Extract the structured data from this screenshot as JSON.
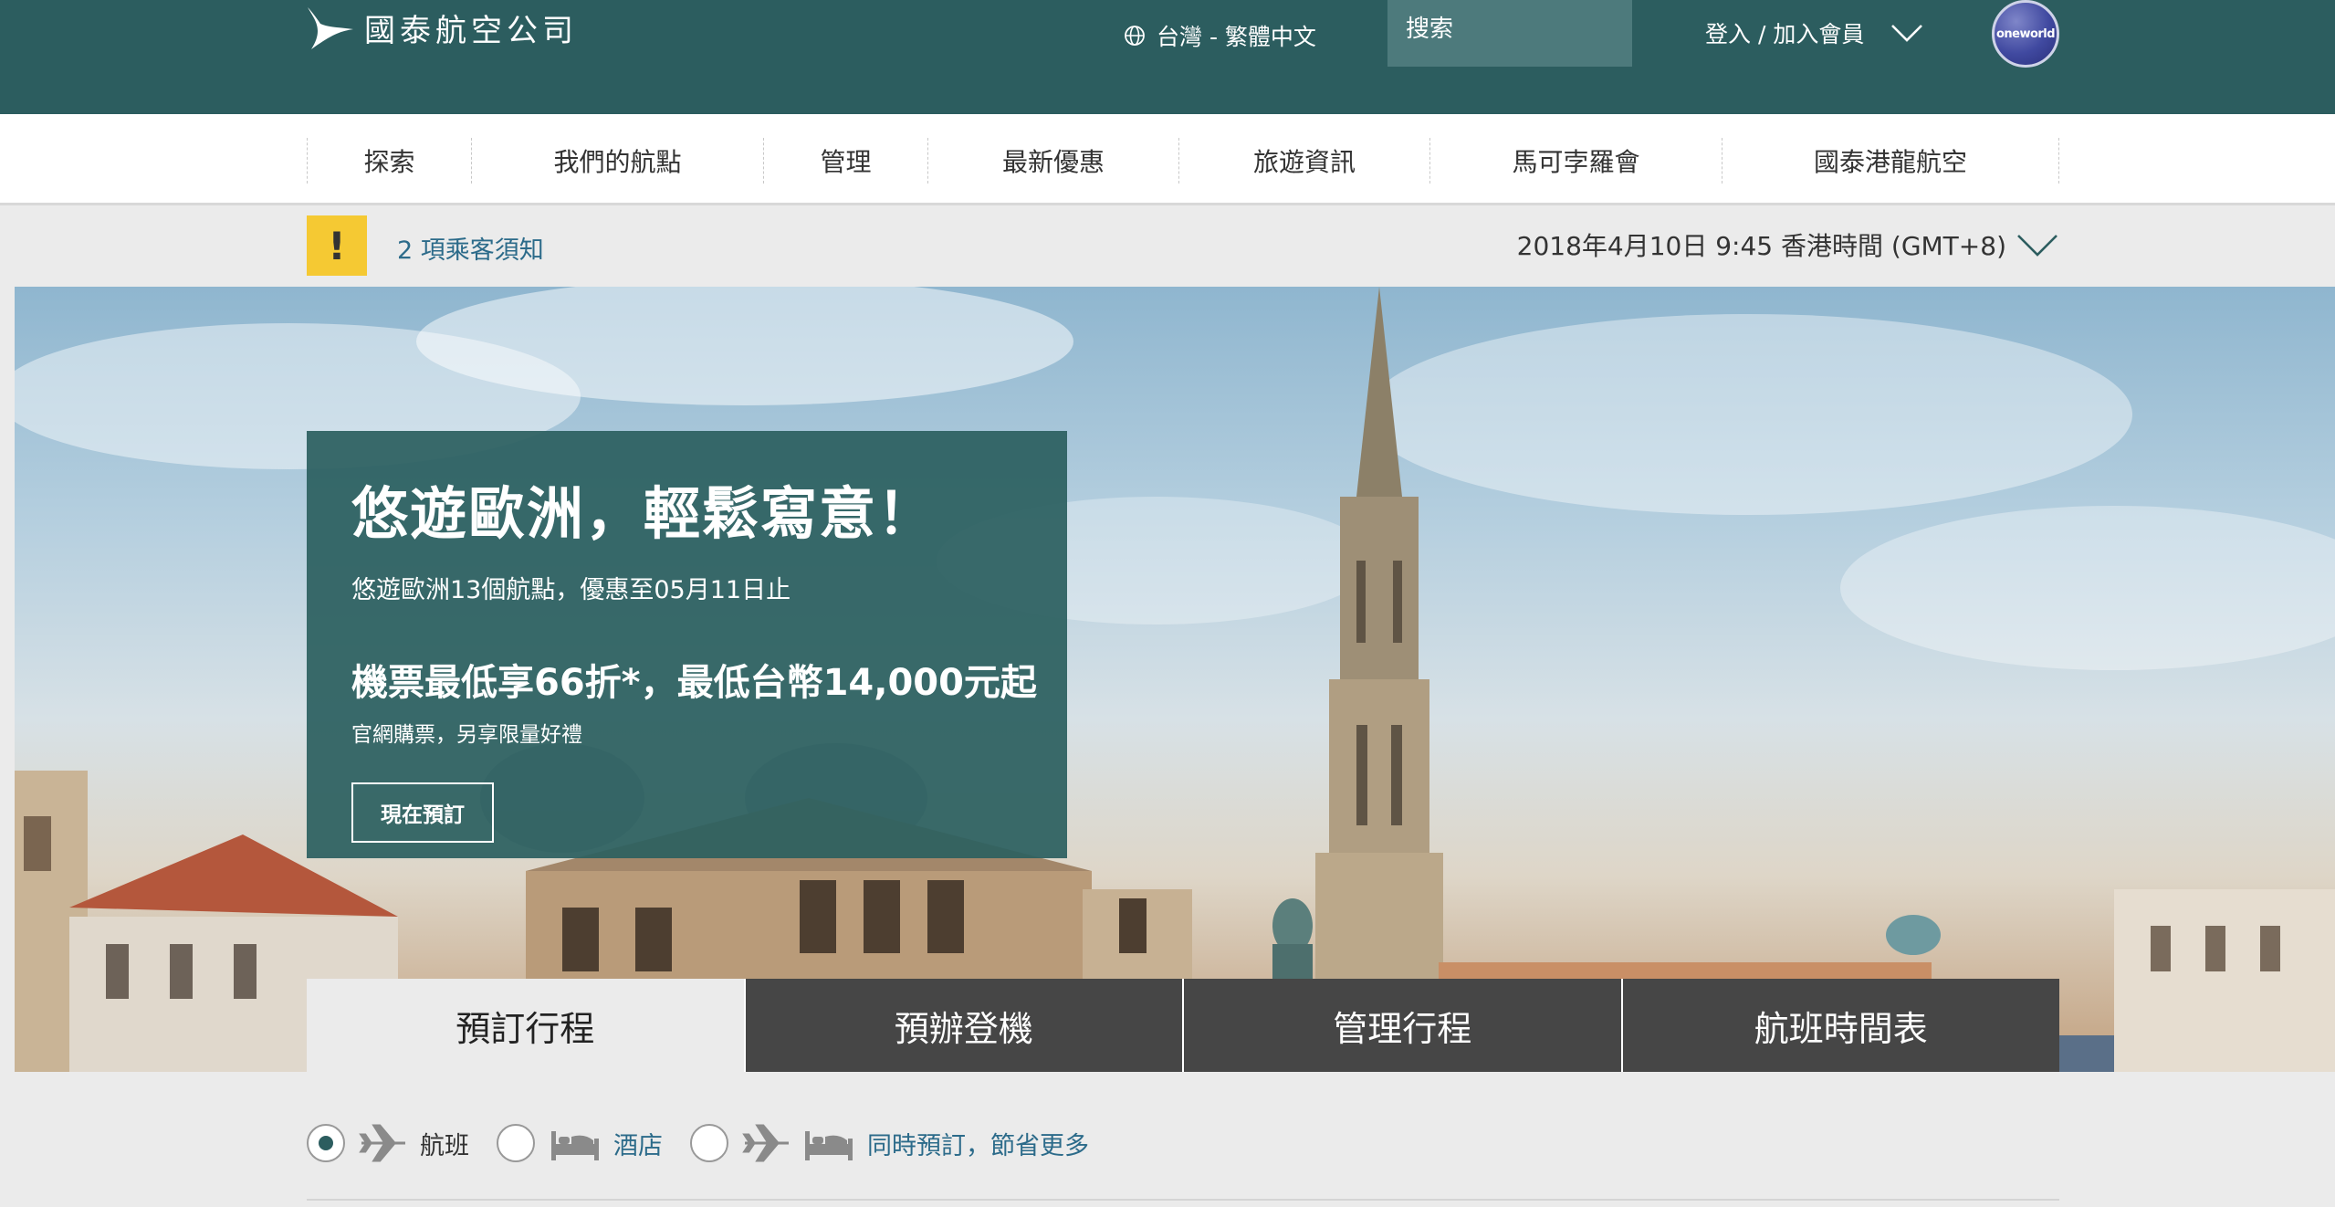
{
  "header": {
    "logo_text": "國泰航空公司",
    "language": "台灣 - 繁體中文",
    "search_placeholder": "搜索",
    "login_label": "登入 / 加入會員",
    "oneworld_label": "oneworld"
  },
  "nav": {
    "items": [
      {
        "label": "探索"
      },
      {
        "label": "我們的航點"
      },
      {
        "label": "管理"
      },
      {
        "label": "最新優惠"
      },
      {
        "label": "旅遊資訊"
      },
      {
        "label": "馬可孛羅會"
      },
      {
        "label": "國泰港龍航空"
      }
    ]
  },
  "notice": {
    "icon": "!",
    "link_label": "2 項乘客須知",
    "datetime": "2018年4月10日 9:45 香港時間 (GMT+8)"
  },
  "promo": {
    "title": "悠遊歐洲，輕鬆寫意！",
    "subtitle": "悠遊歐洲13個航點，優惠至05月11日止",
    "offer": "機票最低享66折*，最低台幣14,000元起",
    "offer_note": "官網購票，另享限量好禮",
    "button_label": "現在預訂"
  },
  "tabs": [
    {
      "label": "預訂行程",
      "active": true
    },
    {
      "label": "預辦登機",
      "active": false
    },
    {
      "label": "管理行程",
      "active": false
    },
    {
      "label": "航班時間表",
      "active": false
    }
  ],
  "booking_options": {
    "flight_label": "航班",
    "hotel_label": "酒店",
    "combo_label": "同時預訂，節省更多",
    "selected": "flight"
  },
  "colors": {
    "brand_teal": "#2c5d5f",
    "search_bg": "#4d7a7c",
    "warning_yellow": "#f5c933",
    "link_blue": "#2c6b8a",
    "tab_dark": "#464646"
  }
}
